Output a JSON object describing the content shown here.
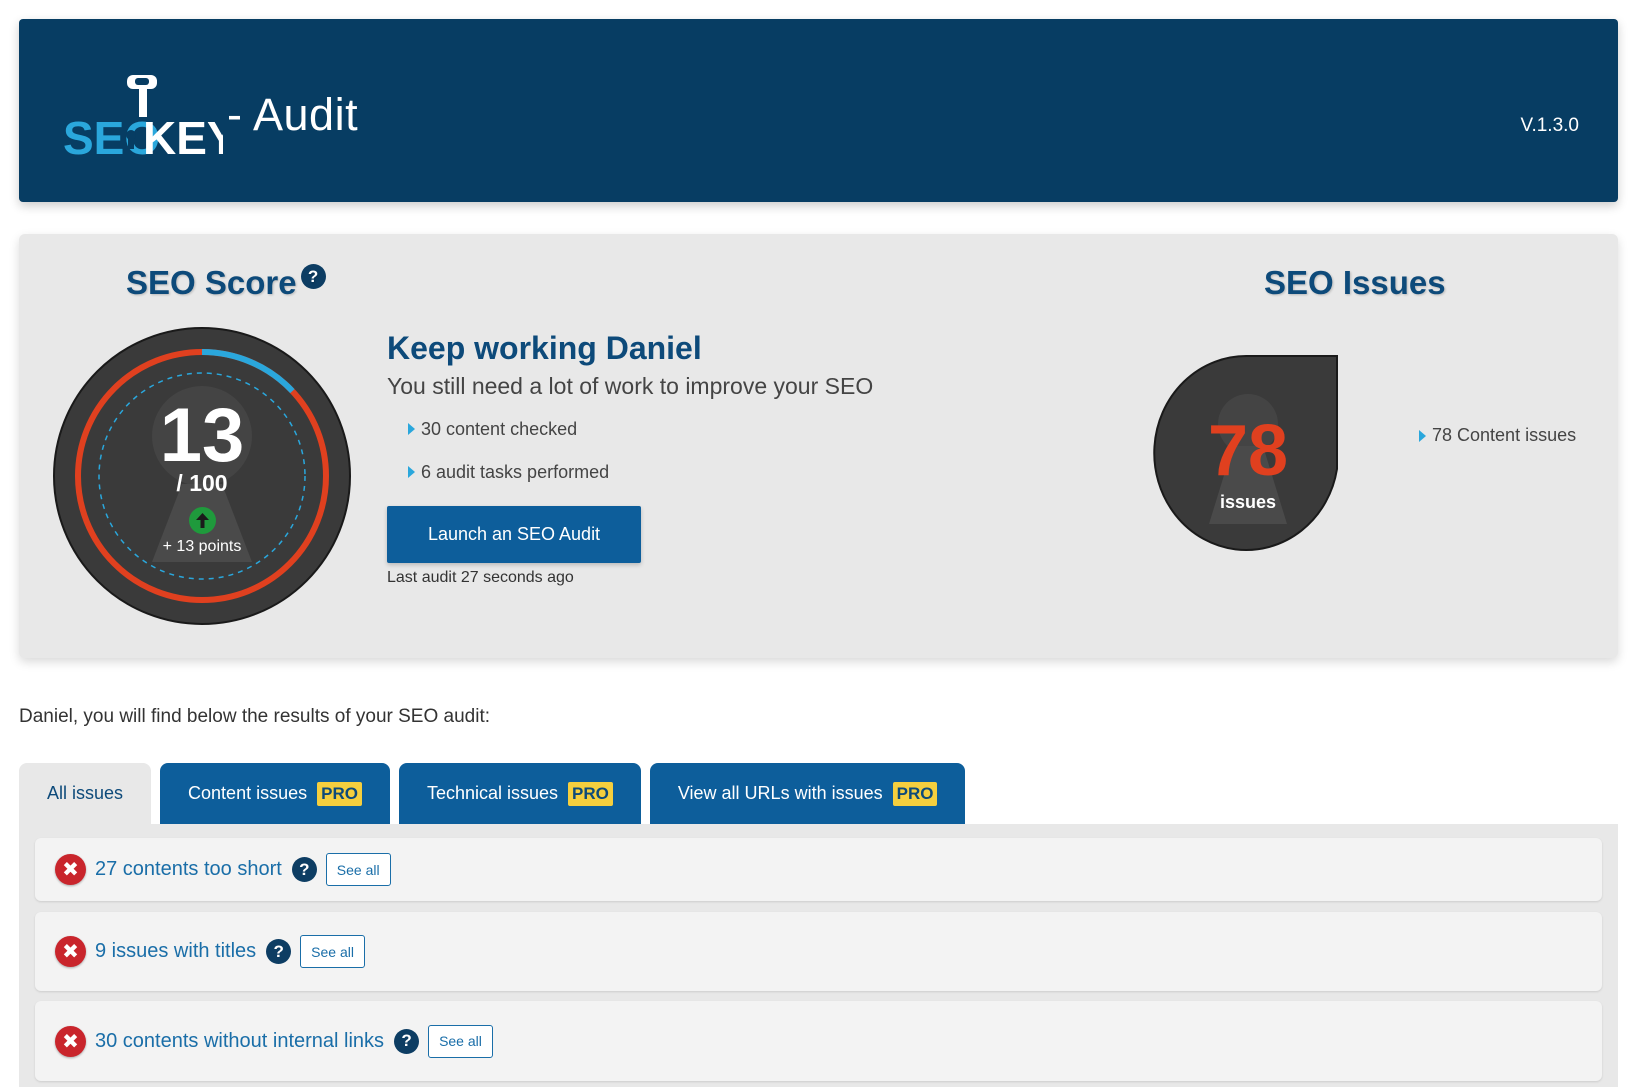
{
  "header": {
    "logo_text_seo": "SEO",
    "logo_text_key": "KEY",
    "title_suffix": "- Audit",
    "version": "V.1.3.0"
  },
  "score": {
    "title": "SEO Score",
    "help_icon": "?",
    "value": "13",
    "max": "/ 100",
    "progress_fraction": 0.13,
    "delta": "+ 13 points",
    "delta_icon": "arrow-up-icon"
  },
  "summary": {
    "title": "Keep working Daniel",
    "subtitle": "You still need a lot of work to improve your SEO",
    "bullets": [
      "30 content checked",
      "6 audit tasks performed"
    ],
    "launch_button": "Launch an SEO Audit",
    "last_audit": "Last audit 27 seconds ago"
  },
  "issues": {
    "title": "SEO Issues",
    "count": "78",
    "count_label": "issues",
    "detail": "78 Content issues"
  },
  "intro": "Daniel, you will find below the results of your SEO audit:",
  "tabs": [
    {
      "label": "All issues",
      "active": true,
      "pro": ""
    },
    {
      "label": "Content issues",
      "active": false,
      "pro": "PRO"
    },
    {
      "label": "Technical issues",
      "active": false,
      "pro": "PRO"
    },
    {
      "label": "View all URLs with issues",
      "active": false,
      "pro": "PRO"
    }
  ],
  "rows": [
    {
      "label": "27 contents too short",
      "see_all": "See all",
      "help": "?",
      "status_icon": "✖"
    },
    {
      "label": "9 issues with titles",
      "see_all": "See all",
      "help": "?",
      "status_icon": "✖"
    },
    {
      "label": "30 contents without internal links",
      "see_all": "See all",
      "help": "?",
      "status_icon": "✖"
    }
  ],
  "colors": {
    "header_bg": "#073d63",
    "brand_blue": "#0d4a7a",
    "button_blue": "#0d5e9b",
    "accent_cyan": "#2aa7dc",
    "error_red": "#e0401f",
    "pro_yellow": "#f5cf3e"
  }
}
